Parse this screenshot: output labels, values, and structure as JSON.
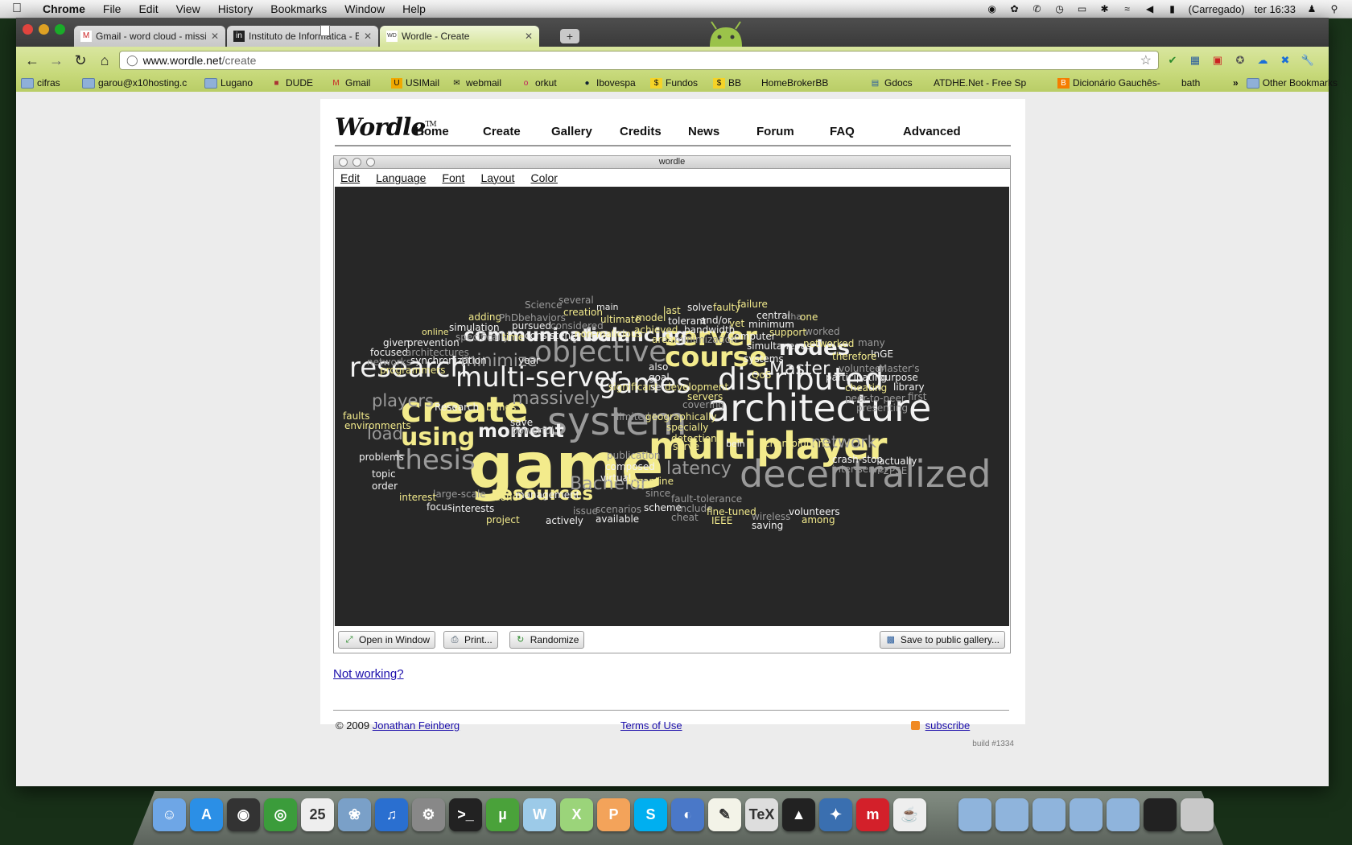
{
  "menubar": {
    "app": "Chrome",
    "items": [
      "File",
      "Edit",
      "View",
      "History",
      "Bookmarks",
      "Window",
      "Help"
    ],
    "battery_status": "(Carregado)",
    "clock": "ter 16:33"
  },
  "tabs": [
    {
      "title": "Gmail - word cloud - missio",
      "favicon": "gmail-icon"
    },
    {
      "title": "Instituto de Informática - Ed",
      "favicon": "inf-icon"
    },
    {
      "title": "Wordle - Create",
      "favicon": "wordle-icon",
      "active": true
    }
  ],
  "address": {
    "host": "www.wordle.net",
    "path": "/create"
  },
  "bookmarks": [
    {
      "label": "cifras",
      "icon": "folder-icon"
    },
    {
      "label": "garou@x10hosting.c",
      "icon": "folder-icon"
    },
    {
      "label": "Lugano",
      "icon": "folder-icon"
    },
    {
      "label": "DUDE",
      "icon": "dude-icon"
    },
    {
      "label": "Gmail",
      "icon": "gmail-icon"
    },
    {
      "label": "USIMail",
      "icon": "usimail-icon"
    },
    {
      "label": "webmail",
      "icon": "mail-icon"
    },
    {
      "label": "orkut",
      "icon": "orkut-icon"
    },
    {
      "label": "Ibovespa",
      "icon": "ibovespa-icon"
    },
    {
      "label": "Fundos",
      "icon": "bb-icon"
    },
    {
      "label": "BB",
      "icon": "bb-icon"
    },
    {
      "label": "HomeBrokerBB",
      "icon": "page-icon"
    },
    {
      "label": "Gdocs",
      "icon": "gdocs-icon"
    },
    {
      "label": "ATDHE.Net - Free Sp",
      "icon": "page-icon"
    },
    {
      "label": "Dicionário Gauchês-",
      "icon": "blogger-icon"
    },
    {
      "label": "bath",
      "icon": "page-icon"
    }
  ],
  "bookmarks_more": "»",
  "other_bookmarks": "Other Bookmarks",
  "wordle": {
    "logo": "Wordle",
    "logo_tm": "TM",
    "nav": [
      "Home",
      "Create",
      "Gallery",
      "Credits",
      "News",
      "Forum",
      "FAQ",
      "Advanced"
    ],
    "applet_title": "wordle",
    "applet_menu": [
      "Edit",
      "Language",
      "Font",
      "Layout",
      "Color"
    ],
    "buttons": {
      "open_window": "Open in Window",
      "print": "Print...",
      "randomize": "Randomize",
      "save_gallery": "Save to public gallery..."
    },
    "not_working": "Not working?",
    "copyright": "© 2009",
    "author": "Jonathan Feinberg",
    "terms": "Terms of Use",
    "subscribe": "subscribe",
    "build": "build #1334"
  },
  "colors": {
    "white": "#f2f2f2",
    "gray": "#9a9a9a",
    "yellow": "#f3eb8c",
    "canvas": "#272727"
  },
  "cloud_words": [
    [
      "game",
      "yellow"
    ],
    [
      "decentralized",
      "gray"
    ],
    [
      "multiplayer",
      "yellow"
    ],
    [
      "architecture",
      "white"
    ],
    [
      "system",
      "gray"
    ],
    [
      "create",
      "yellow"
    ],
    [
      "distributed",
      "white"
    ],
    [
      "multi-server",
      "white"
    ],
    [
      "research",
      "white"
    ],
    [
      "course",
      "yellow"
    ],
    [
      "thesis",
      "gray"
    ],
    [
      "objective",
      "gray"
    ],
    [
      "games",
      "white"
    ],
    [
      "server",
      "yellow"
    ],
    [
      "using",
      "yellow"
    ],
    [
      "nodes",
      "white"
    ],
    [
      "communication",
      "white"
    ],
    [
      "balancing",
      "white"
    ],
    [
      "resources",
      "yellow"
    ],
    [
      "massively",
      "gray"
    ],
    [
      "moment",
      "white"
    ],
    [
      "Master",
      "white"
    ],
    [
      "Bachelor",
      "gray"
    ],
    [
      "latency",
      "gray"
    ],
    [
      "network",
      "gray"
    ],
    [
      "minimize",
      "gray"
    ],
    [
      "players",
      "gray"
    ],
    [
      "load",
      "gray"
    ],
    [
      "Science",
      "gray"
    ],
    [
      "several",
      "gray"
    ],
    [
      "main",
      "white"
    ],
    [
      "solve",
      "white"
    ],
    [
      "faulty",
      "yellow"
    ],
    [
      "failure",
      "yellow"
    ],
    [
      "central",
      "white"
    ],
    [
      "tha",
      "gray"
    ],
    [
      "one",
      "yellow"
    ],
    [
      "adding",
      "yellow"
    ],
    [
      "PhD",
      "gray"
    ],
    [
      "behaviors",
      "gray"
    ],
    [
      "creation",
      "yellow"
    ],
    [
      "ultimate",
      "yellow"
    ],
    [
      "model",
      "yellow"
    ],
    [
      "last",
      "yellow"
    ],
    [
      "tolerant",
      "white"
    ],
    [
      "and/or",
      "white"
    ],
    [
      "yet",
      "yellow"
    ],
    [
      "minimum",
      "white"
    ],
    [
      "simulation",
      "white"
    ],
    [
      "pursued",
      "white"
    ],
    [
      "considered",
      "gray"
    ],
    [
      "achieved",
      "yellow"
    ],
    [
      "bandwidth",
      "white"
    ],
    [
      "worked",
      "gray"
    ],
    [
      "online",
      "yellow"
    ],
    [
      "specifically",
      "gray"
    ],
    [
      "time",
      "yellow"
    ],
    [
      "consistency",
      "white"
    ],
    [
      "non-malicious",
      "yellow"
    ],
    [
      "area",
      "yellow"
    ],
    [
      "minimization",
      "gray"
    ],
    [
      "Computer",
      "white"
    ],
    [
      "support",
      "yellow"
    ],
    [
      "given",
      "white"
    ],
    [
      "prevention",
      "white"
    ],
    [
      "simultaneous",
      "white"
    ],
    [
      "networked",
      "yellow"
    ],
    [
      "many",
      "gray"
    ],
    [
      "focused",
      "white"
    ],
    [
      "architectures",
      "gray"
    ],
    [
      "InGE",
      "white"
    ],
    [
      "therefore",
      "yellow"
    ],
    [
      "networks",
      "gray"
    ],
    [
      "synchronization",
      "white"
    ],
    [
      "year",
      "white"
    ],
    [
      "systems",
      "white"
    ],
    [
      "also",
      "white"
    ],
    [
      "volunteer",
      "gray"
    ],
    [
      "Master's",
      "gray"
    ],
    [
      "goal",
      "white"
    ],
    [
      "QoS",
      "yellow"
    ],
    [
      "participating",
      "white"
    ],
    [
      "purpose",
      "white"
    ],
    [
      "programmers",
      "yellow"
    ],
    [
      "significant",
      "yellow"
    ],
    [
      "set",
      "white"
    ],
    [
      "development",
      "yellow"
    ],
    [
      "cheating",
      "yellow"
    ],
    [
      "library",
      "white"
    ],
    [
      "servers",
      "yellow"
    ],
    [
      "first",
      "gray"
    ],
    [
      "peer-to-peer",
      "gray"
    ],
    [
      "Research",
      "white"
    ],
    [
      "brings",
      "yellow"
    ],
    [
      "covering",
      "gray"
    ],
    [
      "presenting",
      "gray"
    ],
    [
      "faults",
      "yellow"
    ],
    [
      "environments",
      "yellow"
    ],
    [
      "limited",
      "gray"
    ],
    [
      "geographically",
      "yellow"
    ],
    [
      "save",
      "white"
    ],
    [
      "specially",
      "yellow"
    ],
    [
      "powerful",
      "gray"
    ],
    [
      "detection",
      "yellow"
    ],
    [
      "serve",
      "yellow"
    ],
    [
      "bein",
      "white"
    ],
    [
      "champignons",
      "yellow"
    ],
    [
      "problems",
      "white"
    ],
    [
      "publication",
      "gray"
    ],
    [
      "crash-stop",
      "white"
    ],
    [
      "actually",
      "white"
    ],
    [
      "composed",
      "white"
    ],
    [
      "inter-server",
      "gray"
    ],
    [
      "P2PSE",
      "gray"
    ],
    [
      "topic",
      "white"
    ],
    [
      "virtual",
      "white"
    ],
    [
      "byzantine",
      "yellow"
    ],
    [
      "order",
      "white"
    ],
    [
      "large-scale",
      "gray"
    ],
    [
      "since",
      "gray"
    ],
    [
      "interest",
      "yellow"
    ],
    [
      "done",
      "yellow"
    ],
    [
      "management",
      "white"
    ],
    [
      "fault-tolerance",
      "gray"
    ],
    [
      "focus",
      "white"
    ],
    [
      "interests",
      "white"
    ],
    [
      "scenarios",
      "gray"
    ],
    [
      "scheme",
      "white"
    ],
    [
      "include",
      "gray"
    ],
    [
      "fine-tuned",
      "yellow"
    ],
    [
      "volunteers",
      "white"
    ],
    [
      "issue",
      "gray"
    ],
    [
      "available",
      "white"
    ],
    [
      "cheat",
      "gray"
    ],
    [
      "wireless",
      "gray"
    ],
    [
      "among",
      "yellow"
    ],
    [
      "project",
      "yellow"
    ],
    [
      "actively",
      "white"
    ],
    [
      "IEEE",
      "yellow"
    ],
    [
      "saving",
      "white"
    ]
  ]
}
